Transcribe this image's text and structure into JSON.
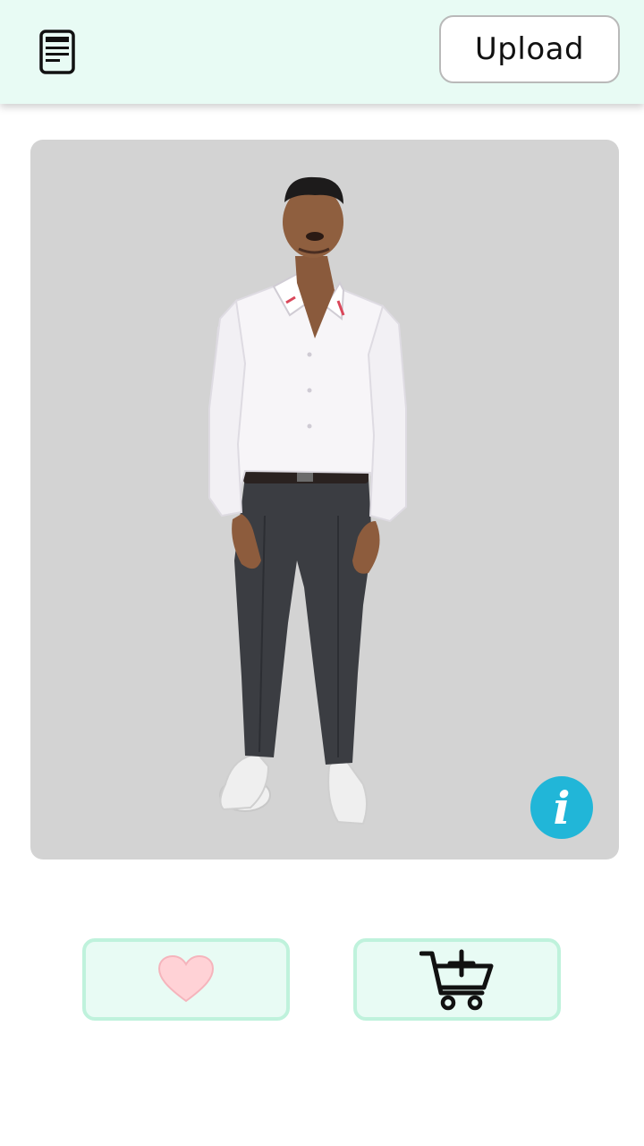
{
  "header": {
    "menu_icon": "document-list-icon",
    "upload_label": "Upload",
    "background": "#e8fbf4"
  },
  "photo": {
    "subject": "person-full-body-photo",
    "background": "#d3d3d3",
    "info_icon": "info-icon",
    "info_color": "#21b6d8"
  },
  "actions": {
    "like_icon": "heart-icon",
    "like_color": "#ffd2d6",
    "cart_icon": "add-to-cart-icon",
    "button_background": "#e8fbf4",
    "button_border": "#bff2dc"
  }
}
